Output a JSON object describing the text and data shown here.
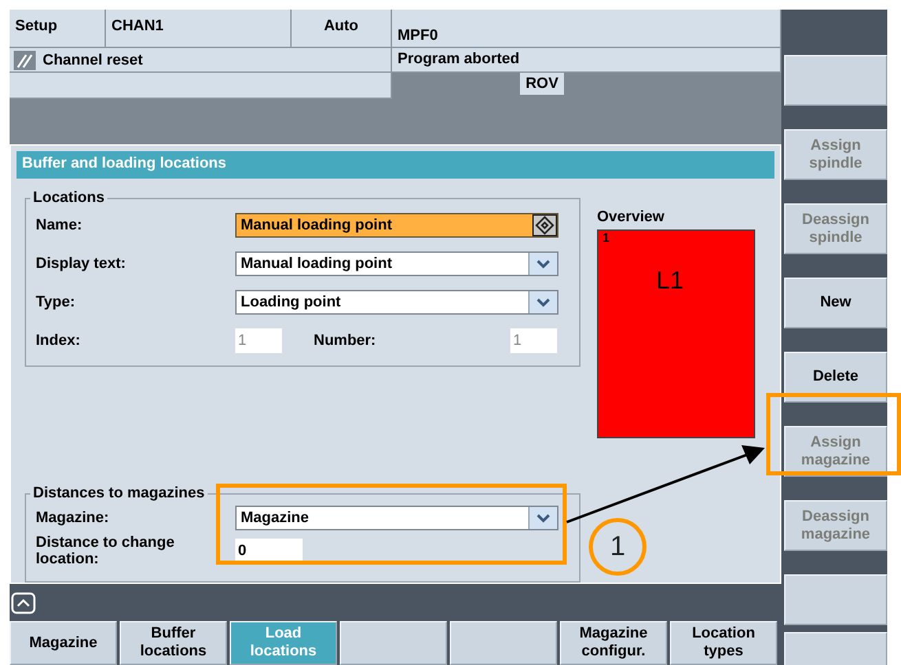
{
  "header": {
    "mode": "Setup",
    "channel": "CHAN1",
    "op_mode": "Auto",
    "program": "MPF0",
    "channel_status": "Channel reset",
    "program_status": "Program aborted",
    "override": "ROV"
  },
  "dialog": {
    "title": "Buffer and loading locations",
    "locations": {
      "title": "Locations",
      "fields": [
        {
          "kind": "edit",
          "label": "Name:",
          "value": "Manual loading point",
          "focused": true
        },
        {
          "kind": "combo",
          "label": "Display text:",
          "value": "Manual loading point"
        },
        {
          "kind": "combo",
          "label": "Type:",
          "value": "Loading point"
        }
      ],
      "index": {
        "label": "Index:",
        "value": "1",
        "disabled": true
      },
      "number": {
        "label": "Number:",
        "value": "1",
        "disabled": true
      }
    },
    "overview": {
      "title": "Overview",
      "index": "1",
      "label": "L1"
    },
    "distances": {
      "title": "Distances to magazines",
      "highlighted": true,
      "magazine": {
        "label": "Magazine:",
        "value": "Magazine"
      },
      "distance": {
        "label": "Distance to change location:",
        "value": "0"
      }
    }
  },
  "callout": "1",
  "softkeys": [
    {
      "kind": "blank"
    },
    {
      "kind": "key",
      "label": "Assign\nspindle",
      "disabled": true,
      "highlighted": false
    },
    {
      "kind": "key",
      "label": "Deassign\nspindle",
      "disabled": true,
      "highlighted": false
    },
    {
      "kind": "key",
      "label": "New",
      "disabled": false,
      "highlighted": false
    },
    {
      "kind": "key",
      "label": "Delete",
      "disabled": false,
      "highlighted": false
    },
    {
      "kind": "key",
      "label": "Assign\nmagazine",
      "disabled": true,
      "highlighted": true
    },
    {
      "kind": "key",
      "label": "Deassign\nmagazine",
      "disabled": true,
      "highlighted": false
    },
    {
      "kind": "blank"
    },
    {
      "kind": "blank"
    }
  ],
  "tabs": [
    {
      "kind": "key",
      "label": "Magazine",
      "selected": false
    },
    {
      "kind": "key",
      "label": "Buffer\nlocations",
      "selected": false
    },
    {
      "kind": "key",
      "label": "Load\nlocations",
      "selected": true
    },
    {
      "kind": "blank"
    },
    {
      "kind": "blank"
    },
    {
      "kind": "key",
      "label": "Magazine\nconfigur.",
      "selected": false
    },
    {
      "kind": "key",
      "label": "Location\ntypes",
      "selected": false
    }
  ]
}
